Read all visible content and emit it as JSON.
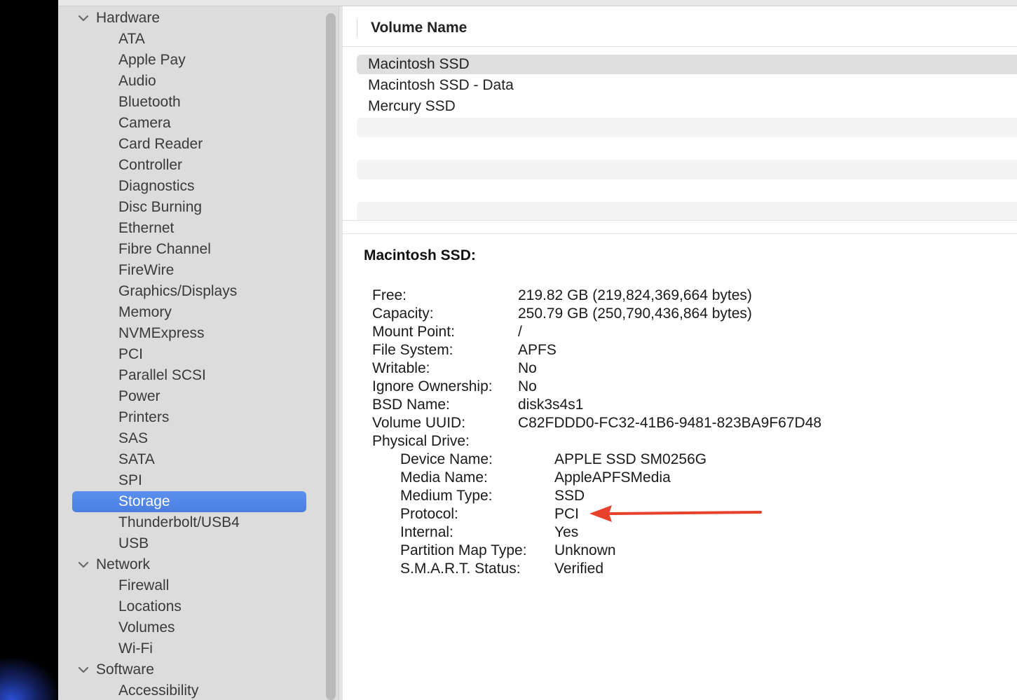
{
  "sidebar": {
    "hardware_label": "Hardware",
    "hardware_items": [
      "ATA",
      "Apple Pay",
      "Audio",
      "Bluetooth",
      "Camera",
      "Card Reader",
      "Controller",
      "Diagnostics",
      "Disc Burning",
      "Ethernet",
      "Fibre Channel",
      "FireWire",
      "Graphics/Displays",
      "Memory",
      "NVMExpress",
      "PCI",
      "Parallel SCSI",
      "Power",
      "Printers",
      "SAS",
      "SATA",
      "SPI",
      "Storage",
      "Thunderbolt/USB4",
      "USB"
    ],
    "network_label": "Network",
    "network_items": [
      "Firewall",
      "Locations",
      "Volumes",
      "Wi-Fi"
    ],
    "software_label": "Software",
    "software_items": [
      "Accessibility"
    ],
    "selected": "Storage"
  },
  "volume_list": {
    "header": "Volume Name",
    "rows": [
      "Macintosh SSD",
      "Macintosh SSD - Data",
      "Mercury SSD"
    ],
    "selected": "Macintosh SSD"
  },
  "details": {
    "title": "Macintosh SSD:",
    "fields": [
      {
        "label": "Free:",
        "value": "219.82 GB (219,824,369,664 bytes)"
      },
      {
        "label": "Capacity:",
        "value": "250.79 GB (250,790,436,864 bytes)"
      },
      {
        "label": "Mount Point:",
        "value": "/"
      },
      {
        "label": "File System:",
        "value": "APFS"
      },
      {
        "label": "Writable:",
        "value": "No"
      },
      {
        "label": "Ignore Ownership:",
        "value": "No"
      },
      {
        "label": "BSD Name:",
        "value": "disk3s4s1"
      },
      {
        "label": "Volume UUID:",
        "value": "C82FDDD0-FC32-41B6-9481-823BA9F67D48"
      },
      {
        "label": "Physical Drive:",
        "value": ""
      }
    ],
    "physical_drive": [
      {
        "label": "Device Name:",
        "value": "APPLE SSD SM0256G"
      },
      {
        "label": "Media Name:",
        "value": "AppleAPFSMedia"
      },
      {
        "label": "Medium Type:",
        "value": "SSD"
      },
      {
        "label": "Protocol:",
        "value": "PCI"
      },
      {
        "label": "Internal:",
        "value": "Yes"
      },
      {
        "label": "Partition Map Type:",
        "value": "Unknown"
      },
      {
        "label": "S.M.A.R.T. Status:",
        "value": "Verified"
      }
    ]
  },
  "annotation": {
    "arrow_color": "#e8412c",
    "points_to": "Protocol:"
  },
  "icons": {
    "group_disclosure": "chevron-down-icon",
    "annotation": "arrow-left-icon"
  },
  "colors": {
    "selection_blue": "#4f85e6",
    "sidebar_bg": "#dcdcdc"
  }
}
